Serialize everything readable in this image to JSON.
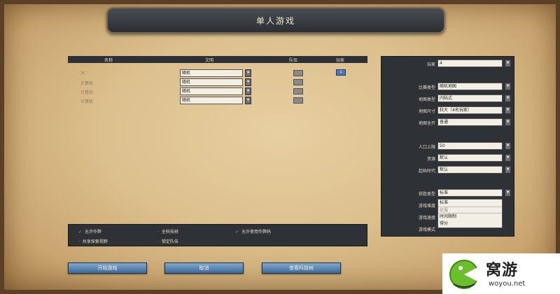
{
  "title": "单人游戏",
  "players_table": {
    "headers": [
      "名称",
      "文明",
      "队伍",
      "玩家"
    ],
    "rows": [
      {
        "name": "3c",
        "civ": "随机",
        "player": "1"
      },
      {
        "name": "计算机",
        "civ": "随机"
      },
      {
        "name": "计算机",
        "civ": "随机"
      },
      {
        "name": "计算机",
        "civ": "随机"
      }
    ]
  },
  "settings": {
    "players_label": "玩家",
    "players_value": "4",
    "match_type_label": "比赛类型",
    "match_type_value": "随机地图",
    "map_type_label": "地图类型",
    "map_type_value": "内陆式",
    "map_size_label": "地图尺寸",
    "map_size_value": "较大（4名玩家）",
    "map_reveal_label": "地图全开",
    "map_reveal_value": "普通",
    "pop_limit_label": "人口上限",
    "pop_limit_value": "50",
    "resources_label": "资源",
    "resources_value": "默认",
    "start_age_label": "起始时代",
    "start_age_value": "默认",
    "victory_label": "获胜类型",
    "victory_value": "标准",
    "difficulty_label": "游戏难度",
    "speed_label": "游戏速度",
    "mode_label": "游戏模式",
    "dropdown_options": [
      "标准",
      "征服",
      "时间限制",
      "得分"
    ]
  },
  "options": {
    "allow_cheats": "允许作弊",
    "all_techs": "全科技树",
    "allow_cheat_codes": "允许使用作弊码",
    "shared_exploration": "共享探索视野",
    "lock_teams": "锁定队伍"
  },
  "buttons": {
    "start": "开始游戏",
    "cancel": "取消",
    "tech_tree": "查看科技树"
  },
  "watermark": {
    "brand": "窝游",
    "url": "woyou.net"
  }
}
